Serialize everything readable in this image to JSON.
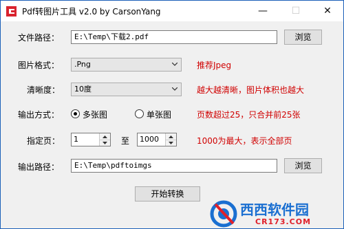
{
  "window": {
    "title": "Pdf转图片工具 v2.0 by CarsonYang",
    "icon": "pdf-app-icon",
    "accent": "#d9232e"
  },
  "controls": {
    "minimize": "—",
    "maximize": "☐",
    "close": "✕"
  },
  "file_path": {
    "label": "文件路径：",
    "value": "E:\\Temp\\下载2.pdf",
    "browse": "浏览"
  },
  "image_format": {
    "label": "图片格式：",
    "value": ".Png",
    "hint": "推荐Jpeg"
  },
  "clarity": {
    "label": "清晰度：",
    "value": "10度",
    "hint": "越大越清晰，图片体积也越大"
  },
  "output_mode": {
    "label": "输出方式：",
    "option_multi": "多张图",
    "option_single": "单张图",
    "selected": "multi",
    "hint": "页数超过25，只合并前25张"
  },
  "pages": {
    "label": "指定页：",
    "from": "1",
    "to_label": "至",
    "to": "1000",
    "hint": "1000为最大，表示全部页"
  },
  "output_path": {
    "label": "输出路径：",
    "value": "E:\\Temp\\pdftoimgs",
    "browse": "浏览"
  },
  "convert_button": "开始转换",
  "watermark": {
    "brand": "西西软件园",
    "url": "CR173.COM"
  },
  "colors": {
    "hint": "#d00000",
    "wm_blue": "#1a6fd1",
    "wm_red": "#e0202a"
  }
}
